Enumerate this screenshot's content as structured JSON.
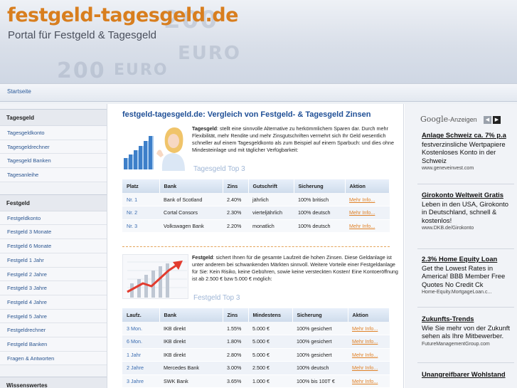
{
  "header": {
    "title": "festgeld-tagesgeld.de",
    "subtitle": "Portal für Festgeld & Tagesgeld",
    "bg_text": [
      "200",
      "EURO",
      "200",
      "EURO"
    ]
  },
  "topnav": {
    "home": "Startseite"
  },
  "sidebar": {
    "sections": [
      {
        "title": "Tagesgeld",
        "items": [
          "Tagesgeldkonto",
          "Tagesgeldrechner",
          "Tagesgeld Banken",
          "Tagesanleihe"
        ]
      },
      {
        "title": "Festgeld",
        "items": [
          "Festgeldkonto",
          "Festgeld 3 Monate",
          "Festgeld 6 Monate",
          "Festgeld 1 Jahr",
          "Festgeld 2 Jahre",
          "Festgeld 3 Jahre",
          "Festgeld 4 Jahre",
          "Festgeld 5 Jahre",
          "Festgeldrechner",
          "Festgeld Banken",
          "Fragen & Antworten"
        ]
      },
      {
        "title": "Wissenswertes",
        "items": []
      }
    ]
  },
  "main": {
    "heading": "festgeld-tagesgeld.de: Vergleich von Festgeld- & Tagesgeld Zinsen",
    "tages": {
      "intro_bold": "Tagesgeld",
      "intro_text": ": stellt eine sinnvolle Alternative zu herkömmlichem Sparen dar. Durch mehr Flexibilität, mehr Rendite und mehr Zinsgutschriften vermehrt sich Ihr Geld wesentlich schneller auf einem Tagesgeldkonto als zum Beispiel auf einem Sparbuch: und dies ohne Mindesteinlage und mit täglicher Verfügbarkeit:",
      "top_title": "Tagesgeld Top 3",
      "columns": [
        "Platz",
        "Bank",
        "Zins",
        "Gutschrift",
        "Sicherung",
        "Aktion"
      ],
      "rows": [
        [
          "Nr. 1",
          "Bank of Scotland",
          "2.40%",
          "jährlich",
          "100% britisch",
          "Mehr Info..."
        ],
        [
          "Nr. 2",
          "Cortal Consors",
          "2.30%",
          "vierteljährlich",
          "100% deutsch",
          "Mehr Info..."
        ],
        [
          "Nr. 3",
          "Volkswagen Bank",
          "2.20%",
          "monatlich",
          "100% deutsch",
          "Mehr Info..."
        ]
      ]
    },
    "fest": {
      "intro_bold": "Festgeld",
      "intro_text": ": sichert Ihnen für die gesamte Laufzeit die hohen Zinsen. Diese Geldanlage ist unter anderem bei schwankenden Märkten sinnvoll. Weitere Vorteile einer Festgeldanlage für Sie: Kein Risiko, keine Gebühren, sowie keine versteckten Kosten! Eine Kontoeröffnung ist ab 2.500 € bzw 5.000 € möglich:",
      "top_title": "Festgeld Top 3",
      "columns": [
        "Laufz.",
        "Bank",
        "Zins",
        "Mindestens",
        "Sicherung",
        "Aktion"
      ],
      "rows": [
        [
          "3 Mon.",
          "IKB direkt",
          "1.55%",
          "5.000 €",
          "100% gesichert",
          "Mehr Info..."
        ],
        [
          "6 Mon.",
          "IKB direkt",
          "1.80%",
          "5.000 €",
          "100% gesichert",
          "Mehr Info..."
        ],
        [
          "1 Jahr",
          "IKB direkt",
          "2.80%",
          "5.000 €",
          "100% gesichert",
          "Mehr Info..."
        ],
        [
          "2 Jahre",
          "Mercedes Bank",
          "3.00%",
          "2.500 €",
          "100% deutsch",
          "Mehr Info..."
        ],
        [
          "3 Jahre",
          "SWK Bank",
          "3.65%",
          "1.000 €",
          "100% bis 100T €",
          "Mehr Info..."
        ]
      ]
    }
  },
  "ads": {
    "label_brand": "Google",
    "label_text": "-Anzeigen",
    "items": [
      {
        "title": "Anlage Schweiz ca. 7% p.a",
        "desc": "festverzinsliche Wertpapiere Kostenloses Konto in der Schweiz",
        "url": "www.geneveinvest.com"
      },
      {
        "title": "Girokonto Weltweit Gratis",
        "desc": "Leben in den USA, Girokonto in Deutschland, schnell & kostenlos!",
        "url": "www.DKB.de/Girokonto"
      },
      {
        "title": "2.3% Home Equity Loan",
        "desc": "Get the Lowest Rates in America! BBB Member Free Quotes No Credit Ck",
        "url": "Home-Equity.MortgageLoan.c..."
      },
      {
        "title": "Zukunfts-Trends",
        "desc": "Wie Sie mehr von der Zukunft sehen als Ihre Mitbewerber.",
        "url": "FutureManagementGroup.com"
      },
      {
        "title": "Unangreifbarer Wohlstand",
        "desc": "",
        "url": ""
      }
    ]
  },
  "colors": {
    "brand_orange": "#d87e1e",
    "heading_blue": "#1f4f96",
    "link_orange": "#e08228"
  }
}
